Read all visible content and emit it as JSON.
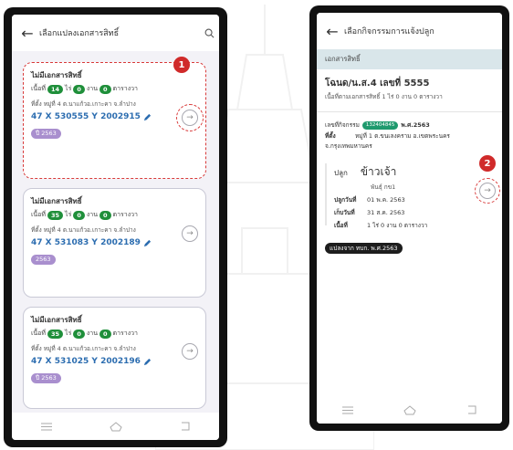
{
  "screen1": {
    "back_glyph": "←",
    "title": "เลือกแปลงเอกสารสิทธิ์",
    "search_icon": "search-icon",
    "cards": [
      {
        "name": "ไม่มีเอกสารสิทธิ์",
        "area_prefix": "เนื้อที่",
        "rai": "14",
        "rai_unit": "ไร่",
        "ngan": "0",
        "ngan_unit": "งาน",
        "wa": "0",
        "wa_unit": "ตารางวา",
        "address": "ที่ตั้ง หมู่ที่ 4 ต.นาแก้วอ.เกาะคา จ.ลำปาง",
        "coord": "47 X 530555 Y 2002915",
        "year": "ปี 2563"
      },
      {
        "name": "ไม่มีเอกสารสิทธิ์",
        "area_prefix": "เนื้อที่",
        "rai": "35",
        "rai_unit": "ไร่",
        "ngan": "0",
        "ngan_unit": "งาน",
        "wa": "0",
        "wa_unit": "ตารางวา",
        "address": "ที่ตั้ง หมู่ที่ 4 ต.นาแก้วอ.เกาะคา จ.ลำปาง",
        "coord": "47 X 531083 Y 2002189",
        "year": "2563"
      },
      {
        "name": "ไม่มีเอกสารสิทธิ์",
        "area_prefix": "เนื้อที่",
        "rai": "35",
        "rai_unit": "ไร่",
        "ngan": "0",
        "ngan_unit": "งาน",
        "wa": "0",
        "wa_unit": "ตารางวา",
        "address": "ที่ตั้ง หมู่ที่ 4 ต.นาแก้วอ.เกาะคา จ.ลำปาง",
        "coord": "47 X 531025 Y 2002196",
        "year": "ปี 2563"
      }
    ],
    "marker": "1"
  },
  "screen2": {
    "back_glyph": "←",
    "title": "เลือกกิจกรรมการแจ้งปลูก",
    "section": "เอกสารสิทธิ์",
    "doc_title": "โฉนด/น.ส.4 เลขที่ 5555",
    "doc_sub": "เนื้อที่ตามเอกสารสิทธิ์ 1 ไร่ 0 งาน 0 ตารางวา",
    "activity_label": "เลขที่กิจกรรม",
    "activity_id": "132404845",
    "activity_year": "พ.ศ.2563",
    "location_label": "ที่ตั้ง",
    "location_value": "หมู่ที่ 1 ต.ขนเลงคราม อ.เขตพระนคร",
    "location_value2": "จ.กรุงเทพมหานคร",
    "plant_label": "ปลูก",
    "crop": "ข้าวเจ้า",
    "variety": "พันธุ์ กข1",
    "planted_label": "ปลูกวันที่",
    "planted_value": "01 พ.ค. 2563",
    "harvest_label": "เก็บวันที่",
    "harvest_value": "31 ส.ค. 2563",
    "area_label": "เนื้อที่",
    "area_value": "1 ไร่ 0 งาน 0 ตารางวา",
    "converted": "แปลงจาก ทบก. พ.ศ.2563",
    "marker": "2"
  },
  "colors": {
    "selection_dash": "#d83a3a",
    "marker": "#d02a2a",
    "green_pill": "#1f8f3a",
    "coord_text": "#2c6db0",
    "purple_pill": "#a98fce",
    "section_bg": "#d9e6ea"
  }
}
